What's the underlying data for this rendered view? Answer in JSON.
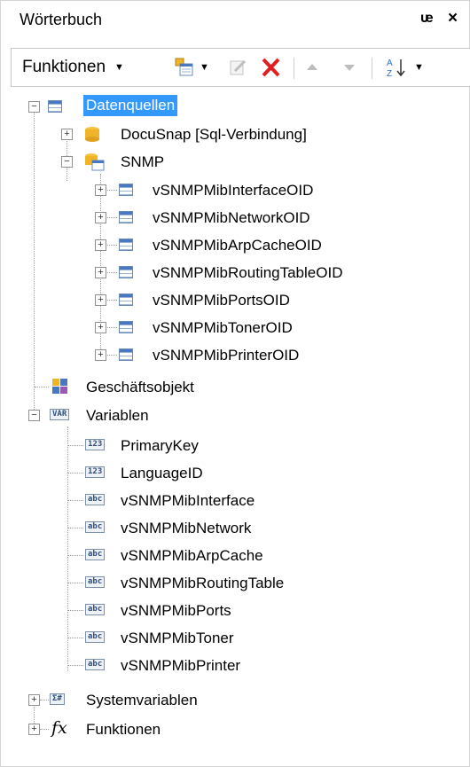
{
  "window": {
    "title": "Wörterbuch",
    "pin_glyph": "ᵾ",
    "close_glyph": "×"
  },
  "toolbar": {
    "functions_label": "Funktionen",
    "caret": "▼",
    "icons": [
      "new-item-icon",
      "edit-icon",
      "delete-icon",
      "move-up-icon",
      "move-down-icon",
      "sort-az-icon"
    ]
  },
  "tree": {
    "datenquellen": "Datenquellen",
    "docusnap": "DocuSnap [Sql-Verbindung]",
    "snmp": "SNMP",
    "snmp_tables": [
      "vSNMPMibInterfaceOID",
      "vSNMPMibNetworkOID",
      "vSNMPMibArpCacheOID",
      "vSNMPMibRoutingTableOID",
      "vSNMPMibPortsOID",
      "vSNMPMibTonerOID",
      "vSNMPMibPrinterOID"
    ],
    "geschaeftsobjekt": "Geschäftsobjekt",
    "variablen": "Variablen",
    "var_badge": "VAR",
    "variables": [
      {
        "badge": "123",
        "name": "PrimaryKey"
      },
      {
        "badge": "123",
        "name": "LanguageID"
      },
      {
        "badge": "abc",
        "name": "vSNMPMibInterface"
      },
      {
        "badge": "abc",
        "name": "vSNMPMibNetwork"
      },
      {
        "badge": "abc",
        "name": "vSNMPMibArpCache"
      },
      {
        "badge": "abc",
        "name": "vSNMPMibRoutingTable"
      },
      {
        "badge": "abc",
        "name": "vSNMPMibPorts"
      },
      {
        "badge": "abc",
        "name": "vSNMPMibToner"
      },
      {
        "badge": "abc",
        "name": "vSNMPMibPrinter"
      }
    ],
    "systemvariablen": "Systemvariablen",
    "sys_badge": "Σ#",
    "funktionen": "Funktionen",
    "fx_glyph": "fx"
  },
  "colors": {
    "selection": "#3399ff",
    "delete": "#e02020",
    "db": "#f0b429"
  }
}
